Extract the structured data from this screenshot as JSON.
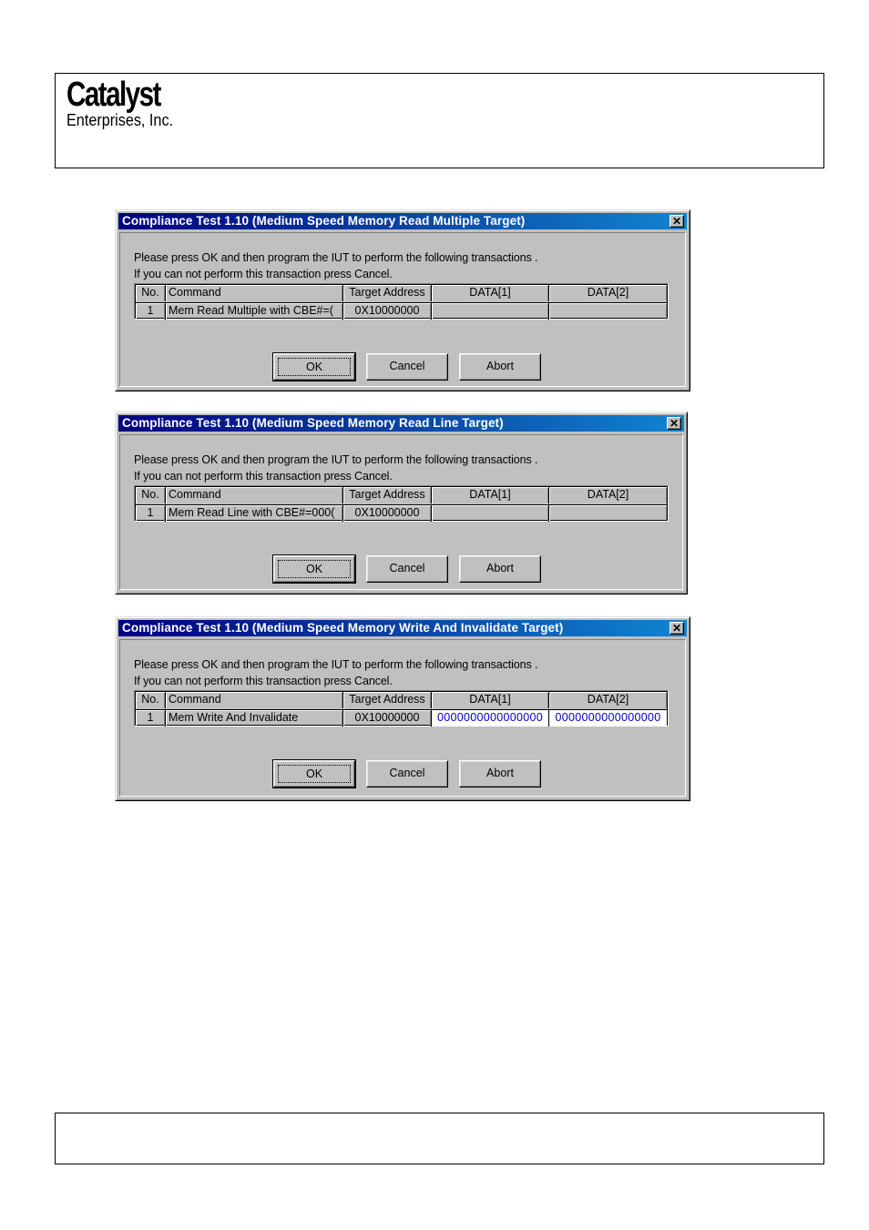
{
  "header": {
    "logo_main": "Catalyst",
    "logo_sub": "Enterprises, Inc."
  },
  "dialogs": [
    {
      "title": "Compliance Test 1.10 (Medium Speed Memory Read Multiple Target)",
      "close_icon": "close-icon",
      "message_line1": "Please press OK and then program the IUT to perform the following transactions .",
      "message_line2": "If you can not perform this transaction press Cancel.",
      "columns": [
        "No.",
        "Command",
        "Target Address",
        "DATA[1]",
        "DATA[2]"
      ],
      "rows": [
        {
          "no": "1",
          "command": "Mem Read Multiple with CBE#=(",
          "address": "0X10000000",
          "data1": "",
          "data2": ""
        }
      ],
      "buttons": {
        "ok": "OK",
        "cancel": "Cancel",
        "abort": "Abort"
      }
    },
    {
      "title": "Compliance Test 1.10 (Medium Speed Memory Read Line Target)",
      "close_icon": "close-icon",
      "message_line1": "Please press OK and then program the IUT to perform the following transactions .",
      "message_line2": "If you can not perform this transaction press Cancel.",
      "columns": [
        "No.",
        "Command",
        "Target Address",
        "DATA[1]",
        "DATA[2]"
      ],
      "rows": [
        {
          "no": "1",
          "command": "Mem Read Line with CBE#=000(",
          "address": "0X10000000",
          "data1": "",
          "data2": ""
        }
      ],
      "buttons": {
        "ok": "OK",
        "cancel": "Cancel",
        "abort": "Abort"
      }
    },
    {
      "title": "Compliance Test 1.10 (Medium Speed Memory Write And Invalidate Target)",
      "close_icon": "close-icon",
      "message_line1": "Please press OK and then program the IUT to perform the following transactions .",
      "message_line2": "If you can not perform this transaction press Cancel.",
      "columns": [
        "No.",
        "Command",
        "Target Address",
        "DATA[1]",
        "DATA[2]"
      ],
      "rows": [
        {
          "no": "1",
          "command": "Mem Write And Invalidate",
          "address": "0X10000000",
          "data1": "0000000000000000",
          "data2": "0000000000000000"
        }
      ],
      "buttons": {
        "ok": "OK",
        "cancel": "Cancel",
        "abort": "Abort"
      }
    }
  ],
  "colors": {
    "titlebar_start": "#000080",
    "titlebar_end": "#1084d0",
    "dialog_face": "#c0c0c0",
    "data_value_text": "#0000cc"
  }
}
